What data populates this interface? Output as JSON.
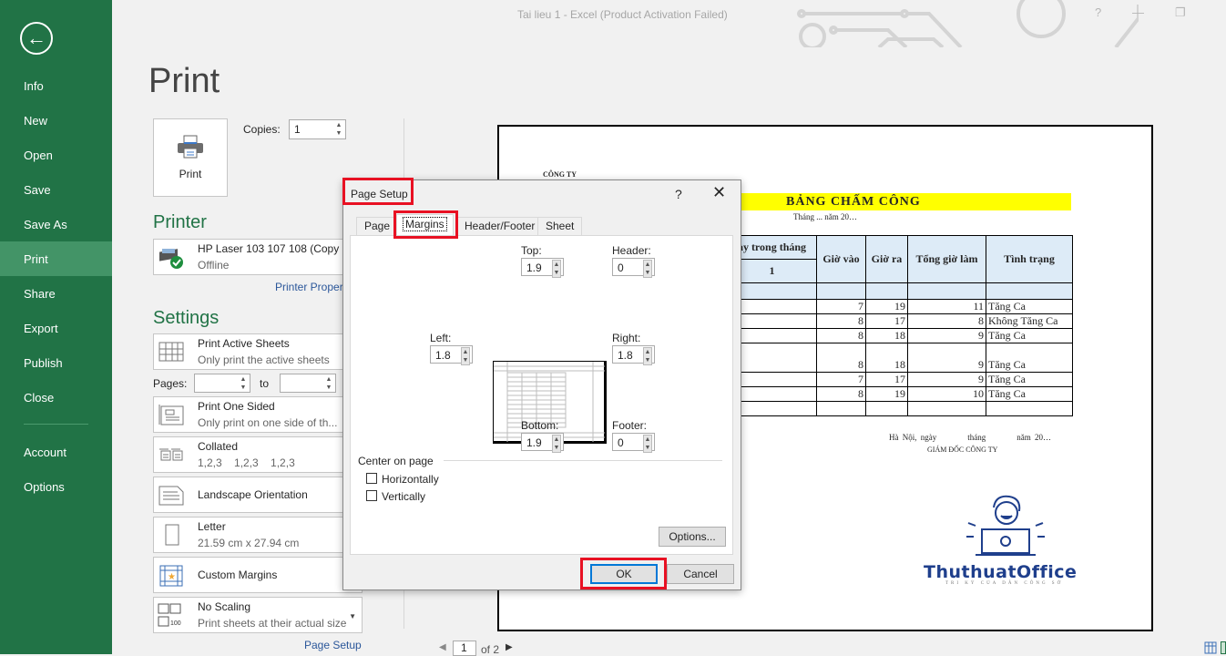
{
  "window": {
    "title": "Tai lieu 1 - Excel (Product Activation Failed)",
    "help": "?",
    "minimize": "—",
    "restore": "❐"
  },
  "sidebar": {
    "back_icon": "←",
    "items": [
      {
        "label": "Info"
      },
      {
        "label": "New"
      },
      {
        "label": "Open"
      },
      {
        "label": "Save"
      },
      {
        "label": "Save As"
      },
      {
        "label": "Print",
        "active": true
      },
      {
        "label": "Share"
      },
      {
        "label": "Export"
      },
      {
        "label": "Publish"
      },
      {
        "label": "Close"
      },
      {
        "label": "Account"
      },
      {
        "label": "Options"
      }
    ]
  },
  "print": {
    "title": "Print",
    "print_button": "Print",
    "copies_label": "Copies:",
    "copies_value": "1",
    "printer_heading": "Printer",
    "printer_name": "HP Laser 103 107 108 (Copy 1)",
    "printer_status": "Offline",
    "printer_properties": "Printer Properties",
    "settings_heading": "Settings",
    "settings": [
      {
        "title": "Print Active Sheets",
        "subtitle": "Only print the active sheets"
      },
      {
        "title": "Print One Sided",
        "subtitle": "Only print on one side of th..."
      },
      {
        "title": "Collated",
        "subtitle": "1,2,3    1,2,3    1,2,3"
      },
      {
        "title": "Landscape Orientation",
        "subtitle": ""
      },
      {
        "title": "Letter",
        "subtitle": "21.59 cm x 27.94 cm"
      },
      {
        "title": "Custom Margins",
        "subtitle": ""
      },
      {
        "title": "No Scaling",
        "subtitle": "Print sheets at their actual size"
      }
    ],
    "pages_label": "Pages:",
    "pages_from": "",
    "pages_to_label": "to",
    "pages_to": "",
    "page_setup_link": "Page Setup"
  },
  "preview": {
    "company": "CÔNG TY",
    "title": "BẢNG CHẤM CÔNG",
    "subtitle": "Tháng ... năm 20…",
    "headers": {
      "days": "ày trong tháng",
      "day_num": "1",
      "in": "Giờ vào",
      "out": "Giờ ra",
      "total": "Tổng giờ làm",
      "status": "Tình trạng"
    },
    "rows": [
      {
        "in": "7",
        "out": "19",
        "total": "11",
        "status": "Tăng Ca"
      },
      {
        "in": "8",
        "out": "17",
        "total": "8",
        "status": "Không Tăng Ca"
      },
      {
        "in": "8",
        "out": "18",
        "total": "9",
        "status": "Tăng Ca"
      },
      {
        "in": "8",
        "out": "18",
        "total": "9",
        "status": "Tăng Ca"
      },
      {
        "in": "7",
        "out": "17",
        "total": "9",
        "status": "Tăng Ca"
      },
      {
        "in": "8",
        "out": "19",
        "total": "10",
        "status": "Tăng Ca"
      }
    ],
    "sign_place": "Hà Nội, ngày        tháng        năm 20…",
    "sign_title": "GIÁM ĐỐC CÔNG TY",
    "logo_text": "ThuthuatOffice",
    "logo_sub": "TRI KỶ CỦA DÂN CÔNG SỞ",
    "page_current": "1",
    "page_of": "of 2"
  },
  "dialog": {
    "title": "Page Setup",
    "help": "?",
    "close": "✕",
    "tabs": [
      {
        "label": "Page"
      },
      {
        "label": "Margins",
        "active": true
      },
      {
        "label": "Header/Footer"
      },
      {
        "label": "Sheet"
      }
    ],
    "top_label": "Top:",
    "top_value": "1.9",
    "header_label": "Header:",
    "header_value": "0",
    "left_label": "Left:",
    "left_value": "1.8",
    "right_label": "Right:",
    "right_value": "1.8",
    "bottom_label": "Bottom:",
    "bottom_value": "1.9",
    "footer_label": "Footer:",
    "footer_value": "0",
    "center_group": "Center on page",
    "horizontally": "Horizontally",
    "horizontally_checked": false,
    "vertically": "Vertically",
    "vertically_checked": false,
    "options_button": "Options...",
    "ok_button": "OK",
    "cancel_button": "Cancel"
  },
  "colors": {
    "accent": "#217346",
    "highlight": "#e81123",
    "link": "#2b579a"
  }
}
